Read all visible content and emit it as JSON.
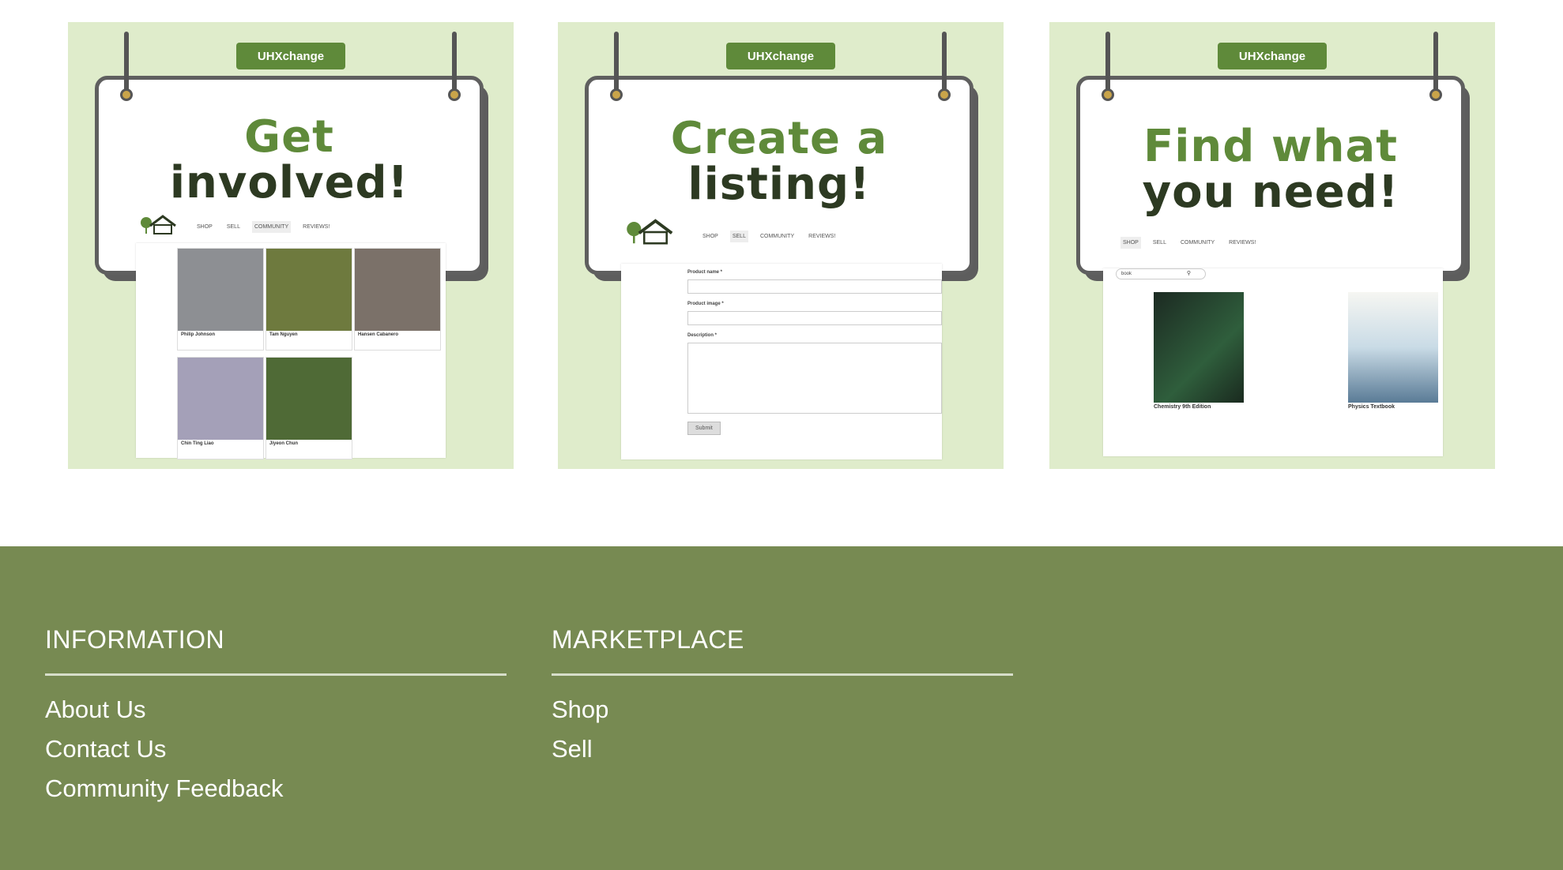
{
  "brand": "UHXchange",
  "cards": [
    {
      "headline_line1": "Get",
      "headline_line2": "involved!",
      "nav": [
        "SHOP",
        "SELL",
        "COMMUNITY",
        "REVIEWS!"
      ],
      "members": [
        "Philip Johnson",
        "Tam Nguyen",
        "Hansen Cabanero",
        "Chin Ting Liao",
        "Jiyeon Chun"
      ]
    },
    {
      "headline_line1": "Create a",
      "headline_line2": "listing!",
      "nav": [
        "SHOP",
        "SELL",
        "COMMUNITY",
        "REVIEWS!"
      ],
      "fields": [
        "Product name *",
        "Product image *",
        "Description *"
      ],
      "submit": "Submit"
    },
    {
      "headline_line1": "Find what",
      "headline_line2": "you need!",
      "nav": [
        "SHOP",
        "SELL",
        "COMMUNITY",
        "REVIEWS!"
      ],
      "search_value": "book",
      "results": [
        "Chemistry 9th Edition",
        "Physics Textbook"
      ]
    }
  ],
  "footer": {
    "information": {
      "heading": "INFORMATION",
      "links": [
        "About Us",
        "Contact Us",
        "Community Feedback"
      ]
    },
    "marketplace": {
      "heading": "MARKETPLACE",
      "links": [
        "Shop",
        "Sell"
      ]
    }
  },
  "colors": {
    "footer_bg": "#778a52",
    "card_bg": "#dfeccb",
    "brand_green": "#5f8a3a"
  }
}
